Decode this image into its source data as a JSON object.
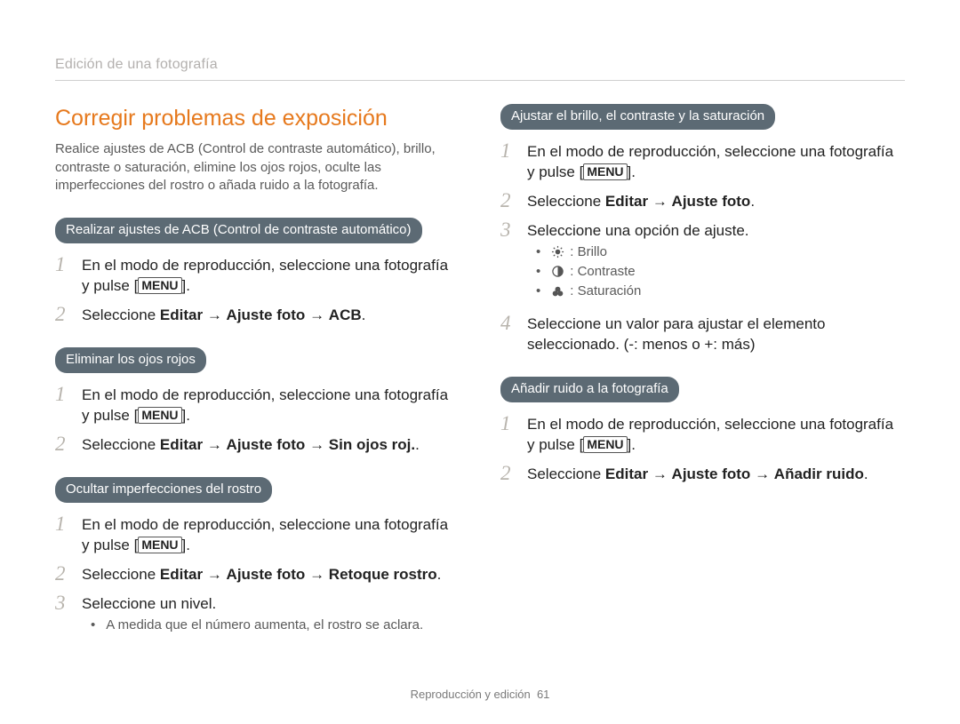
{
  "header": {
    "breadcrumb": "Edición de una fotografía"
  },
  "title": "Corregir problemas de exposición",
  "intro": "Realice ajustes de ACB (Control de contraste automático), brillo, contraste o saturación, elimine los ojos rojos, oculte las imperfecciones del rostro o añada ruido a la fotografía.",
  "arrow": "→",
  "menu_label": "MENU",
  "sections": {
    "acb": {
      "pill": "Realizar ajustes de ACB (Control de contraste automático)",
      "s1a": "En el modo de reproducción, seleccione una fotografía y pulse [",
      "s1b": "].",
      "s2_pre": "Seleccione ",
      "s2_b1": "Editar",
      "s2_b2": "Ajuste foto",
      "s2_b3": "ACB",
      "s2_post": "."
    },
    "redeye": {
      "pill": "Eliminar los ojos rojos",
      "s1a": "En el modo de reproducción, seleccione una fotografía y pulse [",
      "s1b": "].",
      "s2_pre": "Seleccione ",
      "s2_b1": "Editar",
      "s2_b2": "Ajuste foto",
      "s2_b3": "Sin ojos roj.",
      "s2_post": "."
    },
    "face": {
      "pill": "Ocultar imperfecciones del rostro",
      "s1a": "En el modo de reproducción, seleccione una fotografía y pulse [",
      "s1b": "].",
      "s2_pre": "Seleccione ",
      "s2_b1": "Editar",
      "s2_b2": "Ajuste foto",
      "s2_b3": "Retoque rostro",
      "s2_post": ".",
      "s3": "Seleccione un nivel.",
      "note": "A medida que el número aumenta, el rostro se aclara."
    },
    "bcs": {
      "pill": "Ajustar el brillo, el contraste y la saturación",
      "s1a": "En el modo de reproducción, seleccione una fotografía y pulse [",
      "s1b": "].",
      "s2_pre": "Seleccione ",
      "s2_b1": "Editar",
      "s2_b2": "Ajuste foto",
      "s2_post": ".",
      "s3": "Seleccione una opción de ajuste.",
      "opt1": ": Brillo",
      "opt2": ": Contraste",
      "opt3": ": Saturación",
      "s4": "Seleccione un valor para ajustar el elemento seleccionado. (-: menos o +: más)"
    },
    "noise": {
      "pill": "Añadir ruido a la fotografía",
      "s1a": "En el modo de reproducción, seleccione una fotografía y pulse [",
      "s1b": "].",
      "s2_pre": "Seleccione ",
      "s2_b1": "Editar",
      "s2_b2": "Ajuste foto",
      "s2_b3": "Añadir ruido",
      "s2_post": "."
    }
  },
  "footer": {
    "section": "Reproducción y edición",
    "page": "61"
  },
  "nums": {
    "n1": "1",
    "n2": "2",
    "n3": "3",
    "n4": "4"
  }
}
